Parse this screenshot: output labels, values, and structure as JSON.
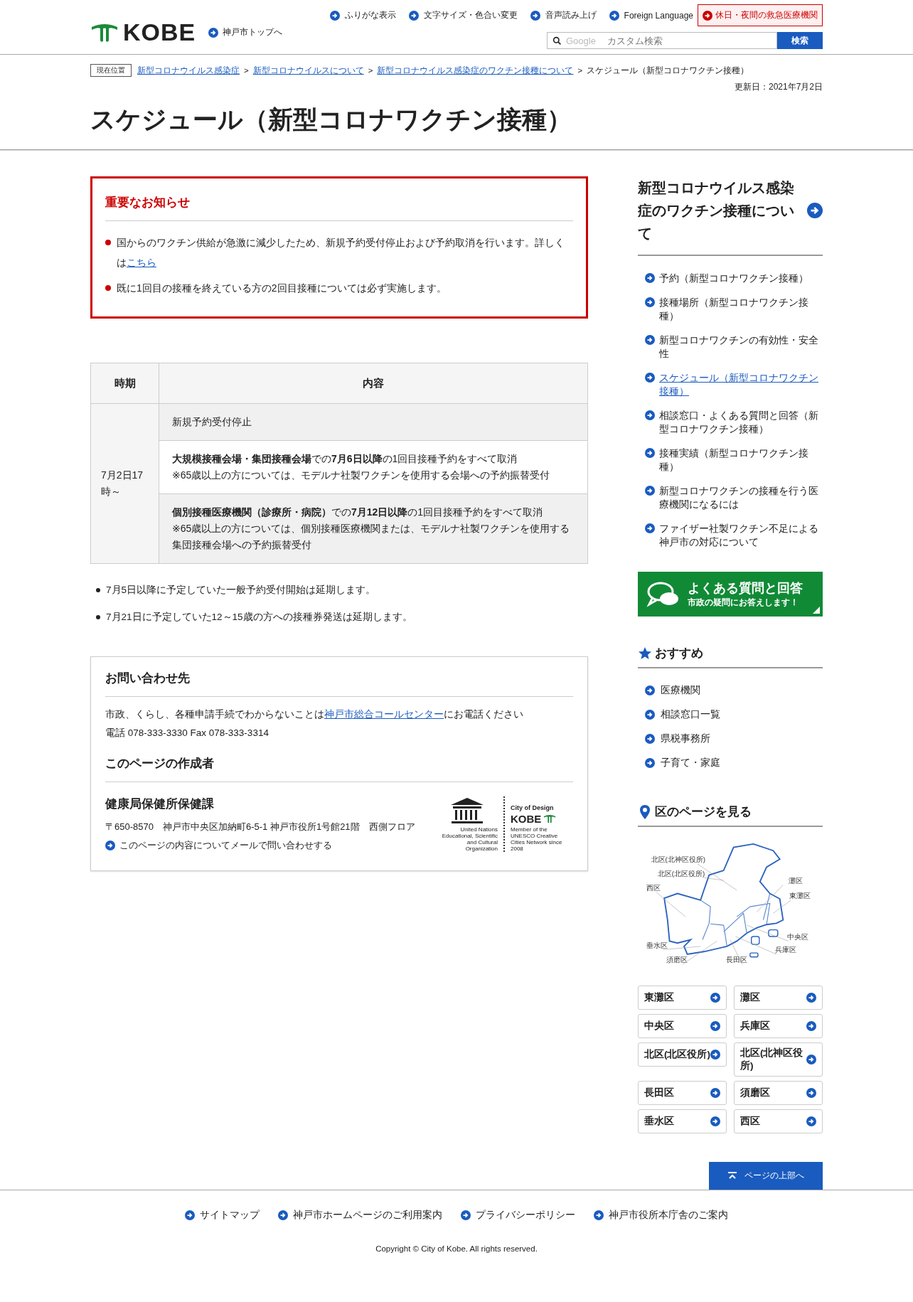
{
  "header": {
    "logo": "KOBE",
    "top_link": "神戸市トップへ",
    "nav": [
      "ふりがな表示",
      "文字サイズ・色合い変更",
      "音声読み上げ",
      "Foreign Language"
    ],
    "emergency_button": "休日・夜間の救急医療機関",
    "search": {
      "brand": "Google",
      "placeholder": "カスタム検索",
      "button": "検索"
    }
  },
  "breadcrumb": {
    "label": "現在位置",
    "separators": [
      ">",
      ">",
      ">"
    ],
    "links": [
      "新型コロナウイルス感染症",
      "新型コロナウイルスについて",
      "新型コロナウイルス感染症のワクチン接種について"
    ],
    "current": "スケジュール（新型コロナワクチン接種）"
  },
  "updated": "更新日：2021年7月2日",
  "title": "スケジュール（新型コロナワクチン接種）",
  "notice": {
    "title": "重要なお知らせ",
    "items": [
      {
        "text": "国からのワクチン供給が急激に減少したため、新規予約受付停止および予約取消を行います。詳しくは",
        "link": "こちら"
      },
      {
        "text": "既に1回目の接種を終えている方の2回目接種については必ず実施します。"
      }
    ]
  },
  "table": {
    "columns": [
      "時期",
      "内容"
    ],
    "rows": [
      {
        "period": "7月2日17時～",
        "contents": [
          {
            "shaded": true,
            "lines": [
              "新規予約受付停止"
            ]
          },
          {
            "shaded": false,
            "lines": [
              "**大規模接種会場・集団接種会場**での**7月6日以降**の1回目接種予約をすべて取消",
              "※65歳以上の方については、モデルナ社製ワクチンを使用する会場への予約振替受付"
            ]
          },
          {
            "shaded": true,
            "lines": [
              "**個別接種医療機関（診療所・病院）**での**7月12日以降**の1回目接種予約をすべて取消",
              "※65歳以上の方については、個別接種医療機関または、モデルナ社製ワクチンを使用する集団接種会場への予約振替受付"
            ]
          }
        ]
      }
    ]
  },
  "notes": [
    "7月5日以降に予定していた一般予約受付開始は延期します。",
    "7月21日に予定していた12～15歳の方への接種券発送は延期します。"
  ],
  "contact": {
    "title": "お問い合わせ先",
    "text_before": "市政、くらし、各種申請手続でわからないことは",
    "link": "神戸市総合コールセンター",
    "text_after": "にお電話ください",
    "phone": "電話 078-333-3330 Fax 078-333-3314",
    "author_title": "このページの作成者",
    "department": "健康局保健所保健課",
    "address": "〒650-8570　神戸市中央区加納町6-5-1 神戸市役所1号館21階　西側フロア",
    "mail_link": "このページの内容についてメールで問い合わせする",
    "logo": {
      "unesco_caption": "United Nations Educational, Scientific and Cultural Organization",
      "city_title": "City of Design",
      "city_name": "KOBE",
      "member_caption": "Member of the UNESCO Creative Cities Network since 2008"
    }
  },
  "sidebar": {
    "heading": "新型コロナウイルス感染症のワクチン接種について",
    "links": [
      {
        "label": "予約（新型コロナワクチン接種）",
        "selected": false
      },
      {
        "label": "接種場所（新型コロナワクチン接種）",
        "selected": false
      },
      {
        "label": "新型コロナワクチンの有効性・安全性",
        "selected": false
      },
      {
        "label": "スケジュール（新型コロナワクチン接種）",
        "selected": true
      },
      {
        "label": "相談窓口・よくある質問と回答（新型コロナワクチン接種）",
        "selected": false
      },
      {
        "label": "接種実績（新型コロナワクチン接種）",
        "selected": false
      },
      {
        "label": "新型コロナワクチンの接種を行う医療機関になるには",
        "selected": false
      },
      {
        "label": "ファイザー社製ワクチン不足による神戸市の対応について",
        "selected": false
      }
    ],
    "faq_banner": {
      "title": "よくある質問と回答",
      "subtitle": "市政の疑問にお答えします！"
    },
    "recommended": {
      "title": "おすすめ",
      "items": [
        "医療機関",
        "相談窓口一覧",
        "県税事務所",
        "子育て・家庭"
      ]
    },
    "wards": {
      "title": "区のページを見る",
      "map_labels": [
        "北区(北神区役所)",
        "北区(北区役所)",
        "西区",
        "灘区",
        "東灘区",
        "中央区",
        "兵庫区",
        "垂水区",
        "須磨区",
        "長田区"
      ],
      "buttons": [
        "東灘区",
        "灘区",
        "中央区",
        "兵庫区",
        "北区(北区役所)",
        "北区(北神区役所)",
        "長田区",
        "須磨区",
        "垂水区",
        "西区"
      ]
    }
  },
  "page_top": "ページの上部へ",
  "footer": {
    "links": [
      "サイトマップ",
      "神戸市ホームページのご利用案内",
      "プライバシーポリシー",
      "神戸市役所本庁舎のご案内"
    ],
    "copyright": "Copyright © City of Kobe. All rights reserved."
  }
}
